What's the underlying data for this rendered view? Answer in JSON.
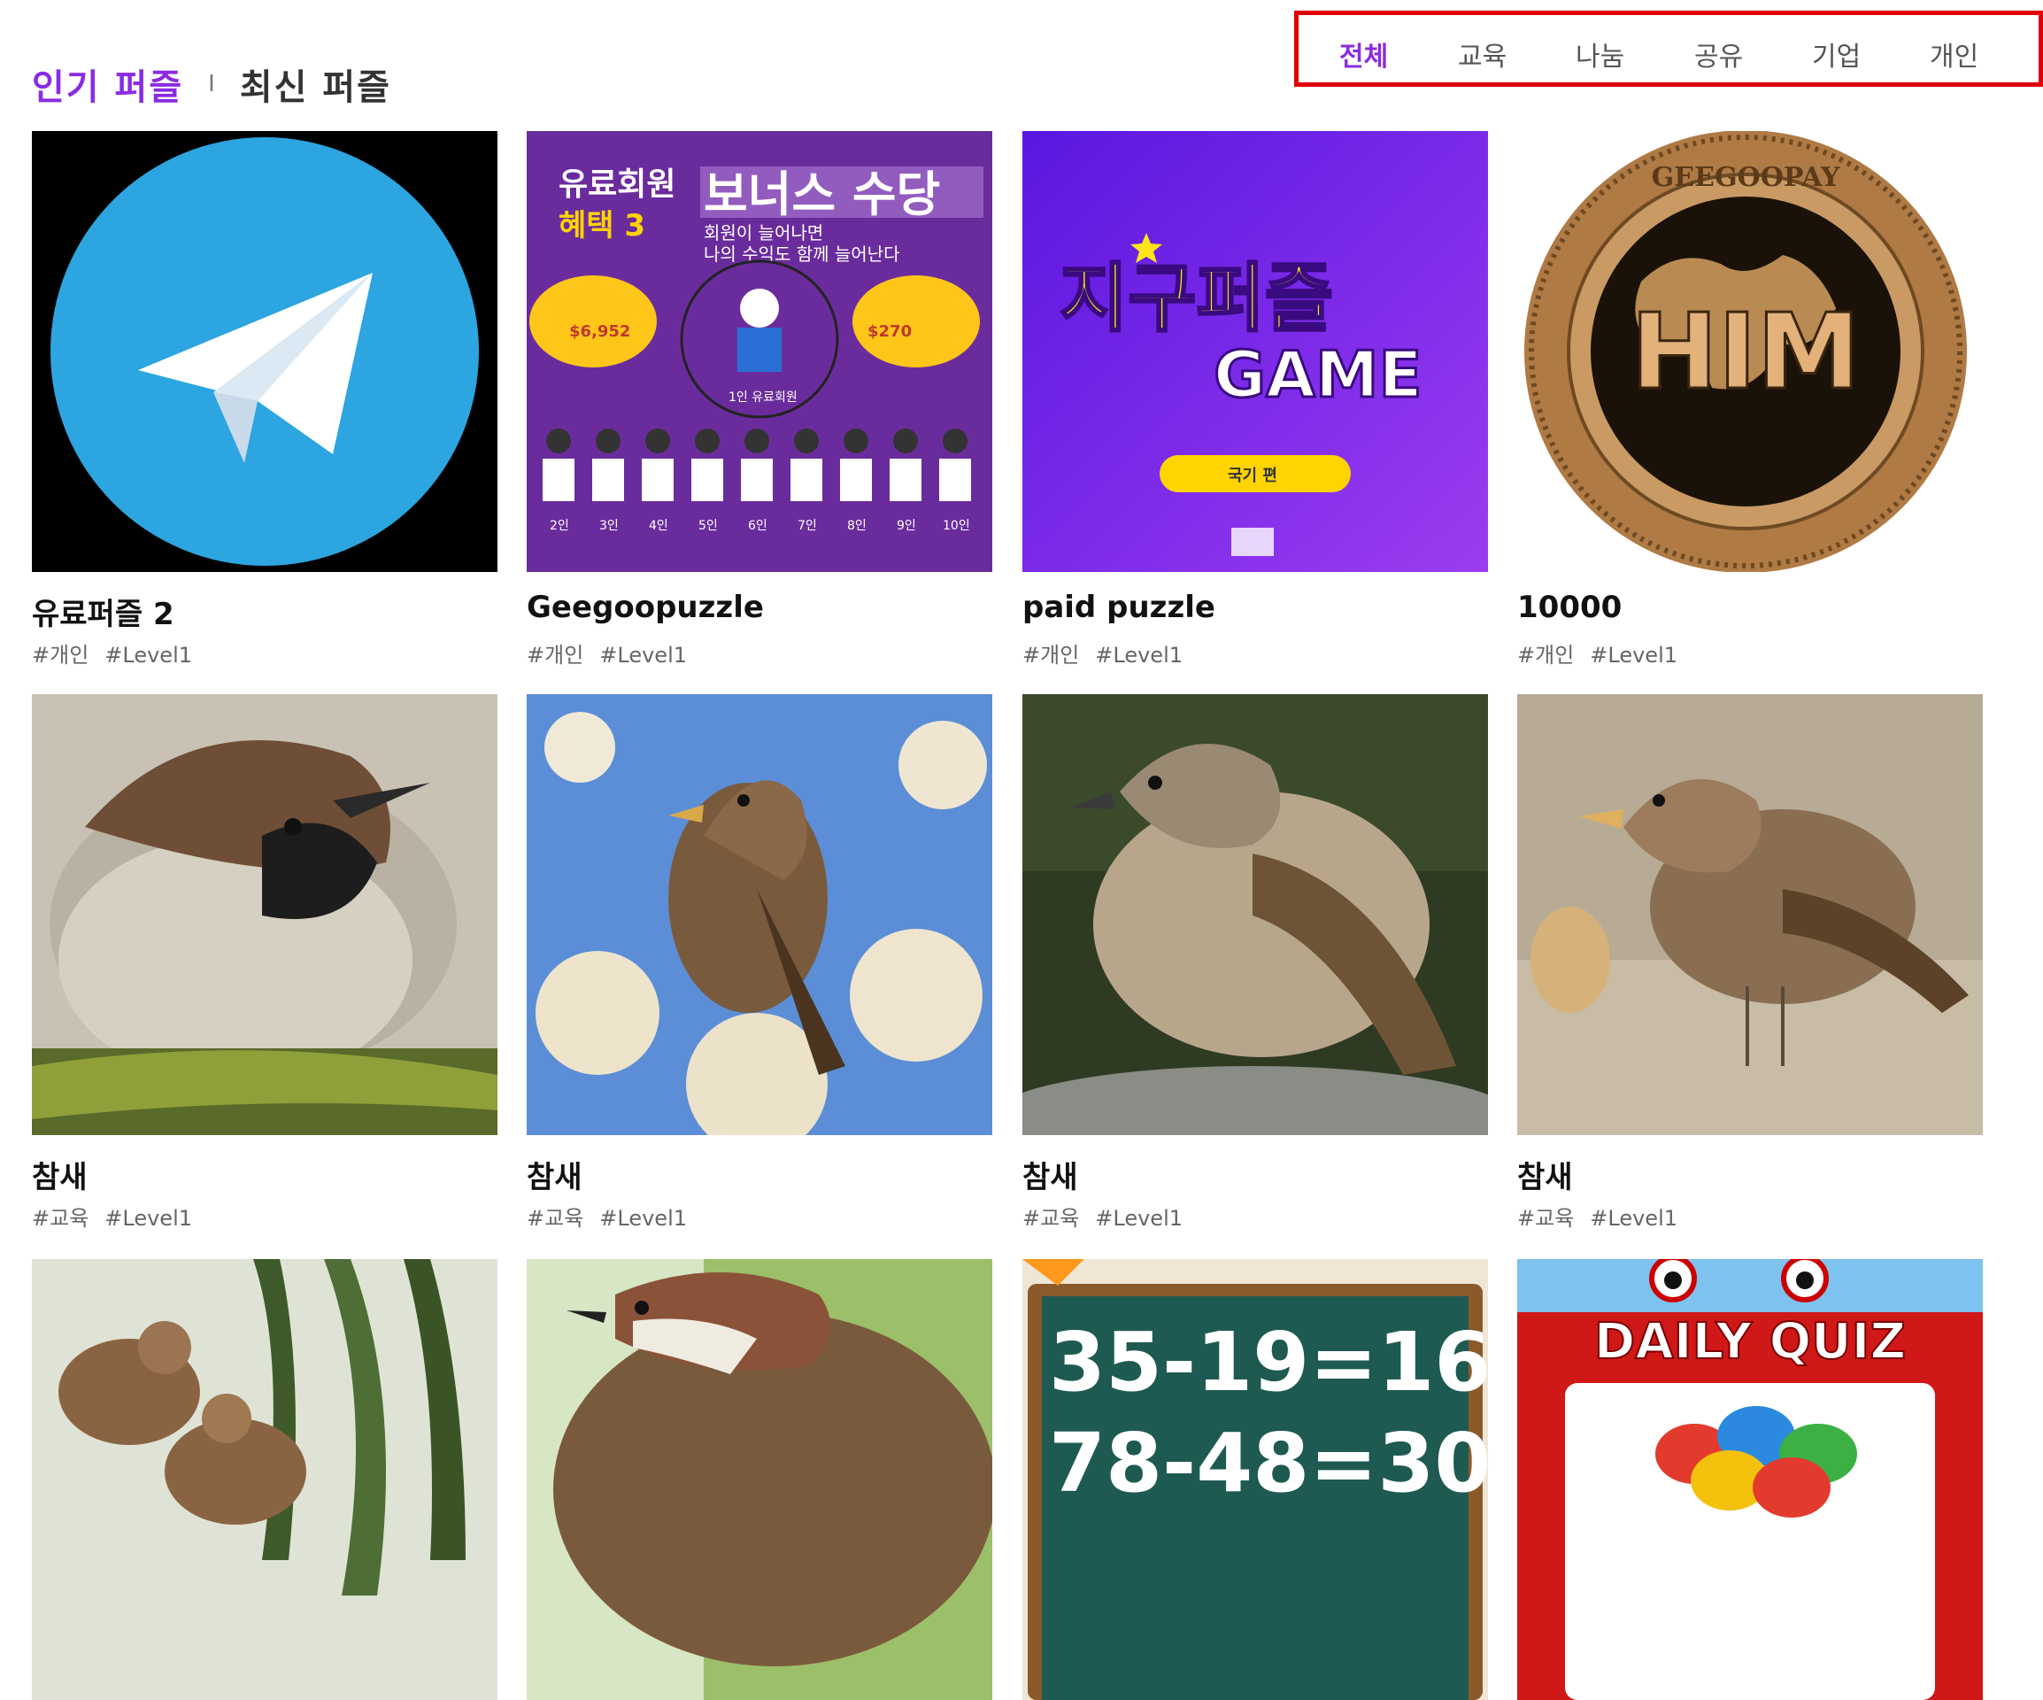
{
  "header": {
    "tab_popular": "인기 퍼즐",
    "tab_divider": "I",
    "tab_latest": "최신 퍼즐"
  },
  "categories": [
    {
      "label": "전체",
      "active": true
    },
    {
      "label": "교육",
      "active": false
    },
    {
      "label": "나눔",
      "active": false
    },
    {
      "label": "공유",
      "active": false
    },
    {
      "label": "기업",
      "active": false
    },
    {
      "label": "개인",
      "active": false
    }
  ],
  "colors": {
    "accent": "#8a2be2",
    "filter_border": "#e00000"
  },
  "puzzles": [
    {
      "title": "유료퍼즐 2",
      "tags": [
        "#개인",
        "#Level1"
      ],
      "image": "telegram-logo"
    },
    {
      "title": "Geegoopuzzle",
      "tags": [
        "#개인",
        "#Level1"
      ],
      "image": "bonus-infographic",
      "image_text": {
        "line1": "유료회원",
        "line2": "혜택 3",
        "headline": "보너스 수당",
        "sub1": "회원이 늘어나면",
        "sub2": "나의 수익도 함께 늘어난다",
        "amount1": "$6,952",
        "amount2": "$270",
        "center_label": "1인 유료회원",
        "numbers": [
          "2인",
          "3인",
          "4인",
          "5인",
          "6인",
          "7인",
          "8인",
          "9인",
          "10인"
        ]
      }
    },
    {
      "title": "paid puzzle",
      "tags": [
        "#개인",
        "#Level1"
      ],
      "image": "earth-puzzle-game",
      "image_text": {
        "line1": "지구퍼즐",
        "line2": "GAME",
        "button": "국기 편"
      }
    },
    {
      "title": "10000",
      "tags": [
        "#개인",
        "#Level1"
      ],
      "image": "him-coin",
      "image_text": {
        "center": "HIM",
        "rim": "GEEGOOPAY"
      }
    },
    {
      "title": "참새",
      "tags": [
        "#교육",
        "#Level1"
      ],
      "image": "sparrow-photo"
    },
    {
      "title": "참새",
      "tags": [
        "#교육",
        "#Level1"
      ],
      "image": "sparrow-photo"
    },
    {
      "title": "참새",
      "tags": [
        "#교육",
        "#Level1"
      ],
      "image": "sparrow-photo"
    },
    {
      "title": "참새",
      "tags": [
        "#교육",
        "#Level1"
      ],
      "image": "sparrow-photo"
    },
    {
      "title": "",
      "tags": [],
      "image": "sparrow-photo"
    },
    {
      "title": "",
      "tags": [],
      "image": "sparrow-photo"
    },
    {
      "title": "",
      "tags": [],
      "image": "math-chalkboard",
      "image_text": {
        "eq1": "35-19=16",
        "eq2": "78-48=30"
      }
    },
    {
      "title": "",
      "tags": [],
      "image": "daily-quiz",
      "image_text": {
        "banner": "DAILY QUIZ"
      }
    }
  ]
}
